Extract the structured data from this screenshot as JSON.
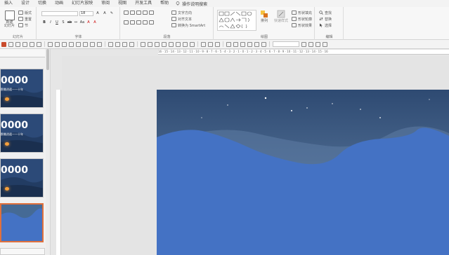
{
  "menu": {
    "tabs": [
      "插入",
      "设计",
      "切换",
      "动画",
      "幻灯片放映",
      "审阅",
      "视图",
      "开发工具",
      "帮助"
    ],
    "search_label": "操作说明搜索"
  },
  "ribbon": {
    "slides_group": {
      "new_slide": "新建\n幻灯片",
      "layout": "版式",
      "reset": "重置",
      "section": "节",
      "label": "幻灯片"
    },
    "font_group": {
      "font_size": "18",
      "label": "字体"
    },
    "paragraph_group": {
      "text_direction": "文字方向",
      "align_text": "对齐文本",
      "convert_smartart": "转换为 SmartArt",
      "label": "段落"
    },
    "drawing_group": {
      "arrange": "排列",
      "quick_styles": "快速样式",
      "shape_fill": "形状填充",
      "shape_outline": "形状轮廓",
      "shape_effects": "形状效果",
      "label": "绘图"
    },
    "editing_group": {
      "find": "查找",
      "replace": "替换",
      "select": "选择",
      "label": "编辑"
    }
  },
  "thumbnails": [
    {
      "big_text": "0000",
      "sub_text": "那美逍遥——十年",
      "active": false
    },
    {
      "big_text": "0000",
      "sub_text": "那美逍遥——十年",
      "active": false
    },
    {
      "big_text": "0000",
      "sub_text": "",
      "active": false
    },
    {
      "big_text": "",
      "sub_text": "",
      "active": true
    }
  ],
  "ruler": {
    "ticks": "16 · 15 · 14 · 13 · 12 · 11 · 10 · 9 · 8 · 7 · 6 · 5 · 4 · 3 · 2 · 1 · 0 · 1 · 2 · 3 · 4 · 5 · 6 · 7 · 8 · 9 · 10 · 11 · 12 · 13 · 14 · 15 · 16"
  },
  "colors": {
    "slide_sky_top": "#2e4a72",
    "slide_sky_bottom": "#6a89ad",
    "slide_hill_blue": "#4472c4",
    "active_tab": "#b7472a",
    "thumb_border_active": "#e0703c"
  }
}
